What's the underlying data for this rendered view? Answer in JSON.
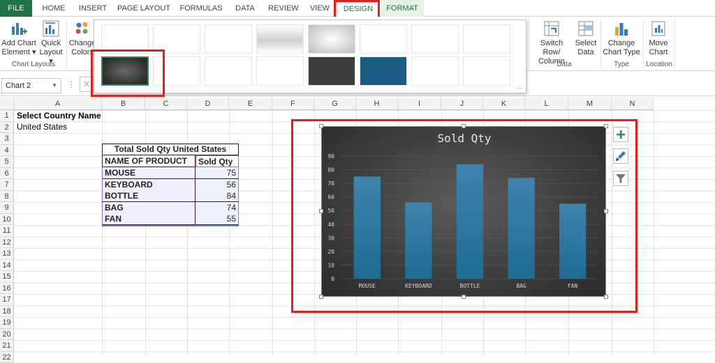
{
  "ribbon_tabs": [
    "FILE",
    "HOME",
    "INSERT",
    "PAGE LAYOUT",
    "FORMULAS",
    "DATA",
    "REVIEW",
    "VIEW",
    "DESIGN",
    "FORMAT"
  ],
  "ribbon": {
    "add_chart_element": [
      "Add Chart",
      "Element ▾"
    ],
    "quick_layout": [
      "Quick",
      "Layout ▾"
    ],
    "chart_layouts_label": "Chart Layouts",
    "change_colors": [
      "Change",
      "Colors"
    ],
    "switch_row_col": [
      "Switch Row/",
      "Column"
    ],
    "select_data": [
      "Select",
      "Data"
    ],
    "data_group_label": "Data",
    "change_chart_type": [
      "Change",
      "Chart Type"
    ],
    "type_group_label": "Type",
    "move_chart": [
      "Move",
      "Chart"
    ],
    "location_group_label": "Location"
  },
  "namebox": "Chart 2",
  "columns": [
    "A",
    "B",
    "C",
    "D",
    "E",
    "F",
    "G",
    "H",
    "I",
    "J",
    "K",
    "L",
    "M",
    "N"
  ],
  "rows": [
    "1",
    "2",
    "3",
    "4",
    "5",
    "6",
    "7",
    "8",
    "9",
    "10",
    "11",
    "12",
    "13",
    "14",
    "15",
    "16",
    "17",
    "18",
    "19",
    "20",
    "21",
    "22"
  ],
  "cells": {
    "a1": "Select Country Name",
    "a2": "United States"
  },
  "table": {
    "title": "Total Sold Qty United States",
    "header_product": "NAME OF PRODUCT",
    "header_qty": "Sold Qty",
    "rows": [
      {
        "product": "MOUSE",
        "qty": "75"
      },
      {
        "product": "KEYBOARD",
        "qty": "56"
      },
      {
        "product": "BOTTLE",
        "qty": "84"
      },
      {
        "product": "BAG",
        "qty": "74"
      },
      {
        "product": "FAN",
        "qty": "55"
      }
    ]
  },
  "chart_data": {
    "type": "bar",
    "title": "Sold Qty",
    "categories": [
      "MOUSE",
      "KEYBOARD",
      "BOTTLE",
      "BAG",
      "FAN"
    ],
    "values": [
      75,
      56,
      84,
      74,
      55
    ],
    "ylim": [
      0,
      90
    ],
    "yticks": [
      0,
      10,
      20,
      30,
      40,
      50,
      60,
      70,
      80,
      90
    ],
    "grid": true,
    "bar_color": "#1d6b94"
  },
  "colors": {
    "excel_green": "#217346",
    "highlight_red": "#e02020"
  }
}
